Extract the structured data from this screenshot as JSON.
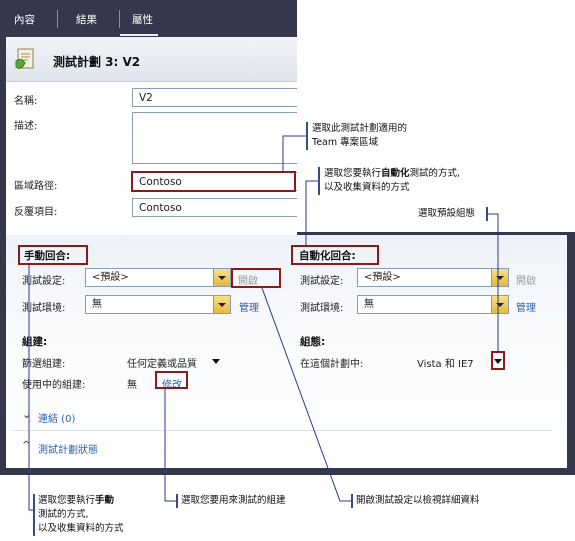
{
  "tabs": [
    {
      "label": "內容"
    },
    {
      "label": "結果"
    },
    {
      "label": "屬性"
    }
  ],
  "header": {
    "title": "測試計劃 3: V2"
  },
  "fields": {
    "name_label": "名稱:",
    "name_value": "V2",
    "desc_label": "描述:",
    "area_label": "區域路徑:",
    "area_value": "Contoso",
    "iteration_label": "反覆項目:",
    "iteration_value": "Contoso"
  },
  "manual": {
    "section": "手動回合:",
    "settings_label": "測試設定:",
    "settings_value": "<預設>",
    "open_link": "開啟",
    "env_label": "測試環境:",
    "env_value": "無",
    "manage_link": "管理"
  },
  "auto": {
    "section": "自動化回合:",
    "settings_label": "測試設定:",
    "settings_value": "<預設>",
    "open_link": "開啟",
    "env_label": "測試環境:",
    "env_value": "無",
    "manage_link": "管理"
  },
  "builds": {
    "section": "組建:",
    "filter_label": "篩選組建:",
    "filter_value": "任何定義或品質",
    "inuse_label": "使用中的組建:",
    "inuse_value": "無",
    "modify_link": "修改"
  },
  "configs": {
    "section": "組態:",
    "plan_label": "在這個計劃中:",
    "plan_value": "Vista 和 IE7"
  },
  "links_row": {
    "label": "連結 (0)"
  },
  "state_row": {
    "label": "測試計劃狀態"
  },
  "callouts": {
    "team_line1": "選取此測試計劃適用的",
    "team_line2": "Team 專案區域",
    "auto_line1_pre": "選取您要執行",
    "auto_line1_bold": "自動化",
    "auto_line1_post": "測試的方式,",
    "auto_line2": "以及收集資料的方式",
    "default_config": "選取預設組態",
    "manual_line1_pre": "選取您要執行",
    "manual_line1_bold": "手動",
    "manual_line2": "測試的方式,",
    "manual_line3": "以及收集資料的方式",
    "builds_text": "選取您要用來測試的組建",
    "open_text": "開啟測試設定以檢視詳細資料"
  },
  "colors": {
    "frame": "#34384a",
    "accent_red": "#8b1a1a",
    "link": "#3060b0",
    "callout_line": "#2a3a8a"
  }
}
